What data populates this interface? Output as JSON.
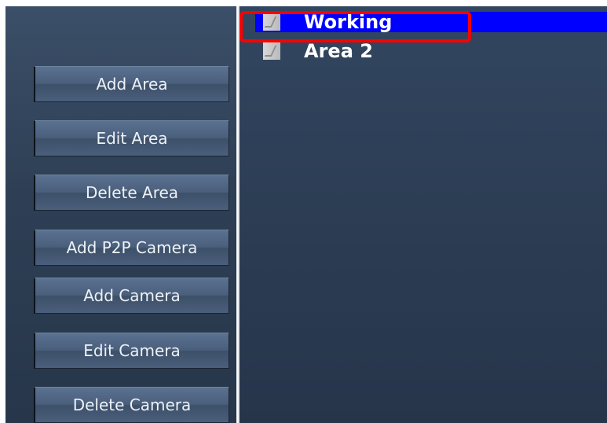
{
  "sidebar": {
    "buttons": [
      {
        "label": "Add Area"
      },
      {
        "label": "Edit Area"
      },
      {
        "label": "Delete Area"
      },
      {
        "label": "Add P2P Camera"
      },
      {
        "label": "Add Camera"
      },
      {
        "label": "Edit Camera"
      },
      {
        "label": "Delete Camera"
      }
    ]
  },
  "tree": {
    "items": [
      {
        "label": "Working",
        "selected": true,
        "icon": "tree-node-icon"
      },
      {
        "label": "Area 2",
        "selected": false,
        "icon": "tree-node-icon"
      }
    ]
  },
  "colors": {
    "selection": "#0000ff",
    "annotation": "#ff0000",
    "panel": "#2f4159"
  }
}
